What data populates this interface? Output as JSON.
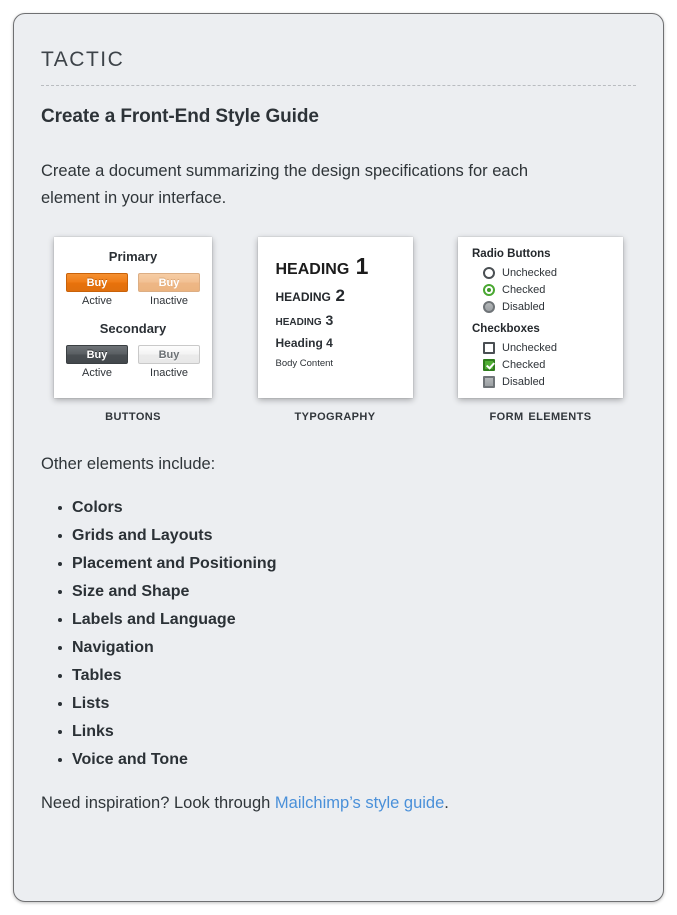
{
  "header": {
    "eyebrow": "Tactic",
    "title": "Create a Front-End Style Guide"
  },
  "intro": "Create a document summarizing the design specifications for each element in your interface.",
  "cards": {
    "buttons": {
      "caption": "Buttons",
      "groups": [
        {
          "title": "Primary",
          "buttons": [
            {
              "label": "Buy",
              "state": "Active"
            },
            {
              "label": "Buy",
              "state": "Inactive"
            }
          ]
        },
        {
          "title": "Secondary",
          "buttons": [
            {
              "label": "Buy",
              "state": "Active"
            },
            {
              "label": "Buy",
              "state": "Inactive"
            }
          ]
        }
      ]
    },
    "typography": {
      "caption": "Typography",
      "samples": [
        "Heading 1",
        "Heading 2",
        "Heading 3",
        "Heading 4",
        "Body Content"
      ]
    },
    "form": {
      "caption": "Form Elements",
      "radio_title": "Radio Buttons",
      "radio_items": [
        "Unchecked",
        "Checked",
        "Disabled"
      ],
      "checkbox_title": "Checkboxes",
      "checkbox_items": [
        "Unchecked",
        "Checked",
        "Disabled"
      ]
    }
  },
  "other": {
    "label": "Other elements include:",
    "items": [
      "Colors",
      "Grids and Layouts",
      "Placement and Positioning",
      "Size and Shape",
      "Labels and Language",
      "Navigation",
      "Tables",
      "Lists",
      "Links",
      "Voice and Tone"
    ]
  },
  "footer": {
    "prefix": "Need inspiration? Look through ",
    "link_text": "Mailchimp’s style guide",
    "suffix": "."
  },
  "colors": {
    "accent_orange": "#ef7b16",
    "accent_green": "#4fae33",
    "link_blue": "#4a90d9",
    "page_background": "#eceef1",
    "card_background": "#ffffff",
    "text": "#2f3539"
  }
}
